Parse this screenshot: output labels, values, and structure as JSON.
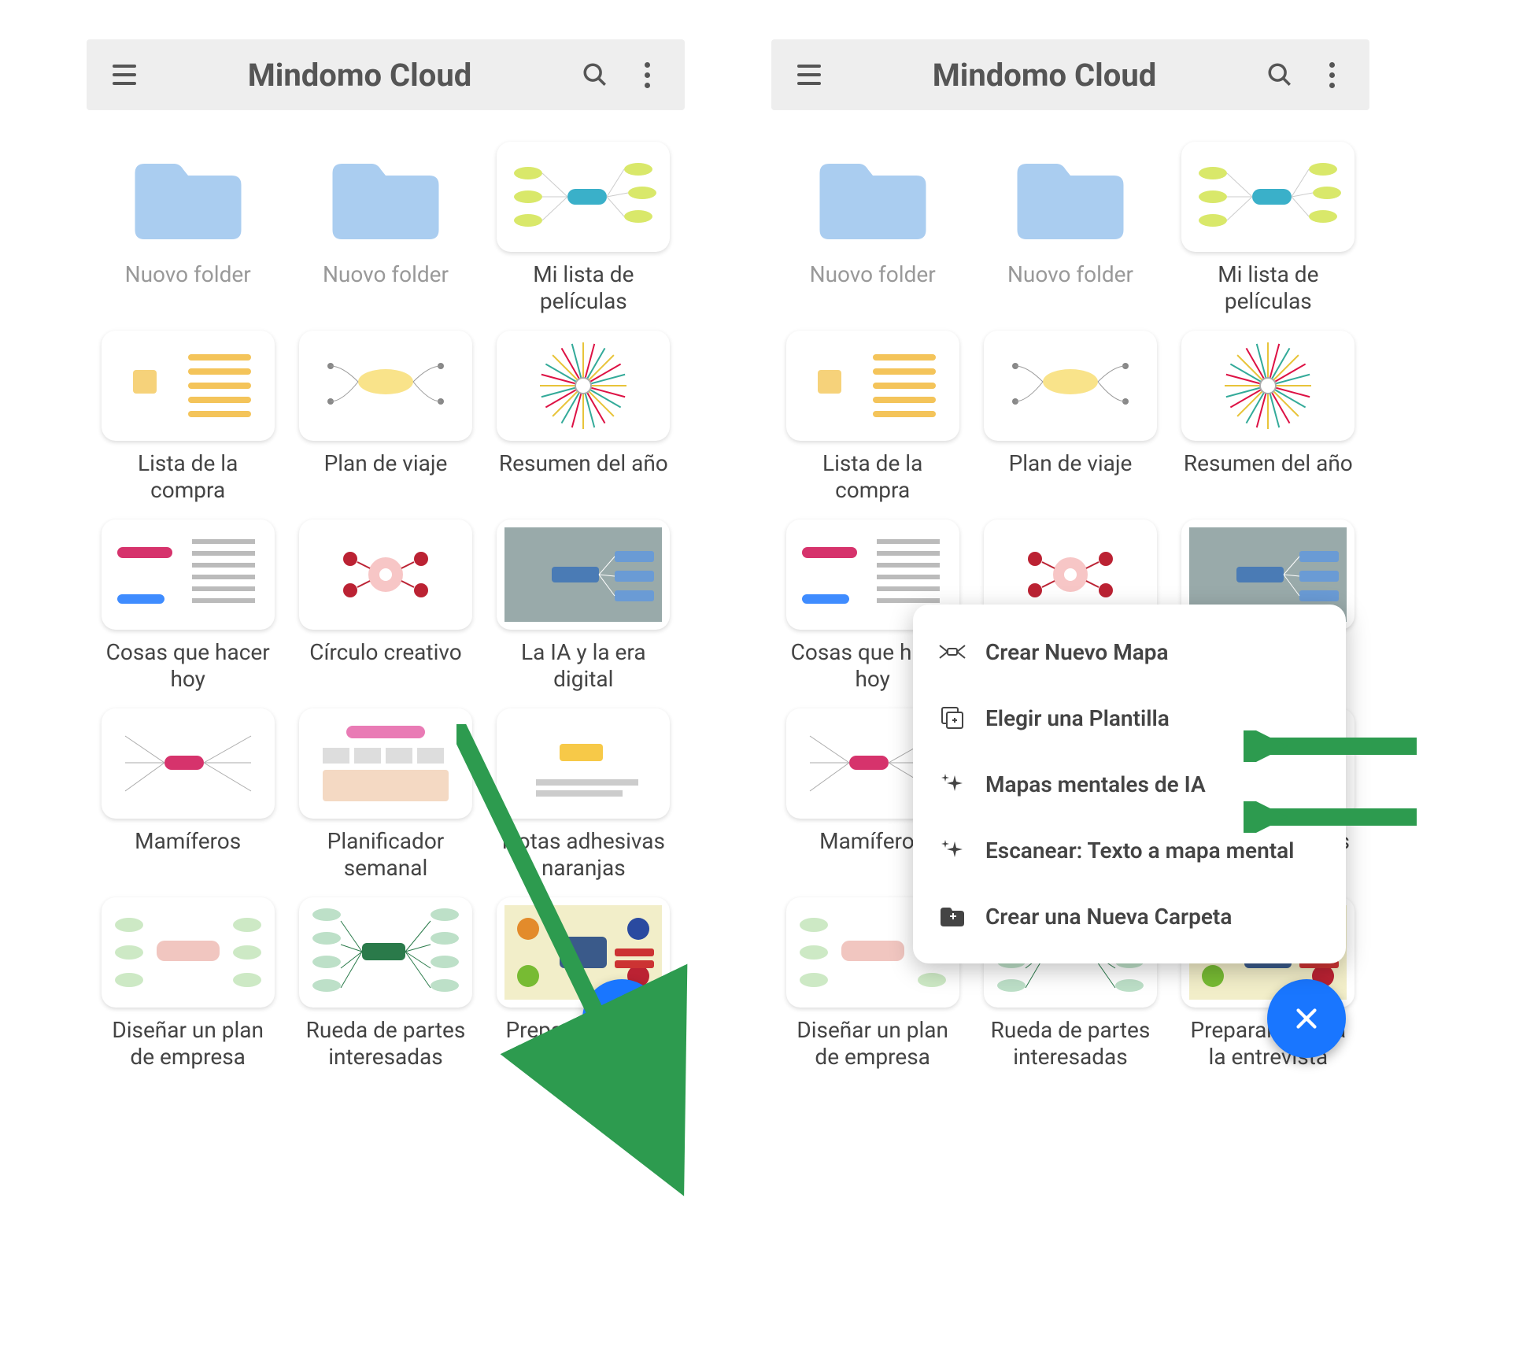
{
  "header": {
    "title": "Mindomo Cloud"
  },
  "items": [
    {
      "label": "Nuovo folder",
      "type": "folder"
    },
    {
      "label": "Nuovo folder",
      "type": "folder"
    },
    {
      "label": "Mi lista de películas",
      "type": "map",
      "thumb": "green"
    },
    {
      "label": "Lista de la compra",
      "type": "map",
      "thumb": "list"
    },
    {
      "label": "Plan de viaje",
      "type": "map",
      "thumb": "plan"
    },
    {
      "label": "Resumen del año",
      "type": "map",
      "thumb": "radial"
    },
    {
      "label": "Cosas que hacer hoy",
      "type": "map",
      "thumb": "todo"
    },
    {
      "label": "Círculo creativo",
      "type": "map",
      "thumb": "circle"
    },
    {
      "label": "La IA y la era digital",
      "type": "map",
      "thumb": "ia"
    },
    {
      "label": "Mamíferos",
      "type": "map",
      "thumb": "mam"
    },
    {
      "label": "Planificador semanal",
      "type": "map",
      "thumb": "week"
    },
    {
      "label": "Notas adhesivas naranjas",
      "type": "map",
      "thumb": "notes"
    },
    {
      "label": "Diseñar un plan de empresa",
      "type": "map",
      "thumb": "biz"
    },
    {
      "label": "Rueda de partes interesadas",
      "type": "map",
      "thumb": "wheel"
    },
    {
      "label": "Prepararse para la entrevista",
      "type": "map",
      "thumb": "prep"
    }
  ],
  "fab": {
    "plus_label": "+",
    "close_label": "×"
  },
  "popup": {
    "items": [
      {
        "label": "Crear Nuevo Mapa",
        "icon": "map"
      },
      {
        "label": "Elegir una Plantilla",
        "icon": "template"
      },
      {
        "label": "Mapas mentales de IA",
        "icon": "sparkle"
      },
      {
        "label": "Escanear: Texto a mapa mental",
        "icon": "sparkle"
      },
      {
        "label": "Crear una Nueva Carpeta",
        "icon": "folder-plus"
      }
    ]
  },
  "colors": {
    "folder": "#aacdf0",
    "accent": "#1976ff",
    "arrow": "#2d9b4f"
  }
}
